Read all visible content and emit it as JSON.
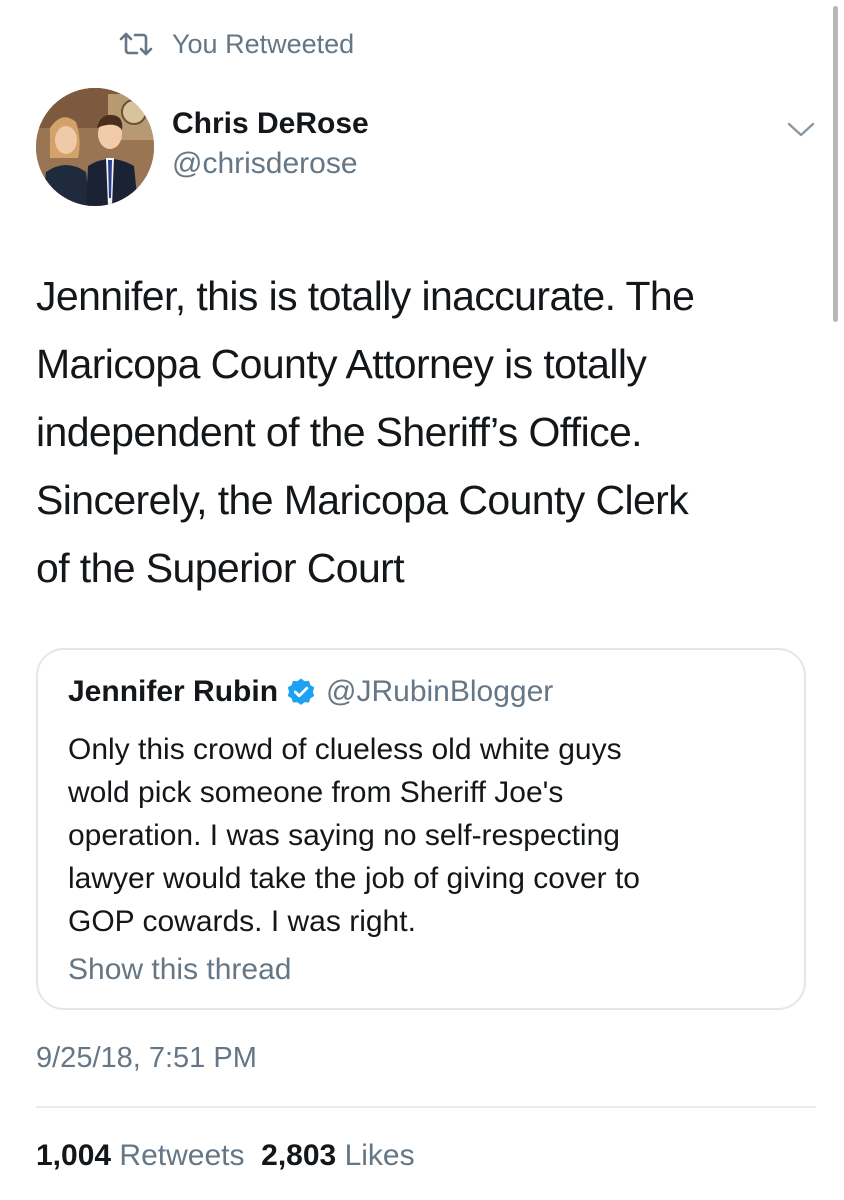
{
  "retweet_context": {
    "icon": "retweet-icon",
    "label": "You Retweeted"
  },
  "tweet": {
    "author": {
      "display_name": "Chris DeRose",
      "handle": "@chrisderose",
      "avatar": "avatar-photo"
    },
    "menu_icon": "chevron-down-icon",
    "text_lines": [
      "Jennifer, this is totally inaccurate.  The",
      "Maricopa County Attorney is totally",
      "independent of the Sheriff’s Office.",
      "Sincerely, the Maricopa County Clerk",
      "of the Superior Court"
    ],
    "quoted_tweet": {
      "display_name": "Jennifer Rubin",
      "verified_icon": "verified-badge-icon",
      "handle": "@JRubinBlogger",
      "text_lines": [
        "Only this crowd of clueless old white guys",
        "wold pick someone from Sheriff Joe's",
        "operation. I was saying no self-respecting",
        "lawyer would take the job of giving cover to",
        "GOP cowards. I was right."
      ],
      "show_thread_label": "Show this thread"
    },
    "timestamp": "9/25/18, 7:51 PM",
    "stats": {
      "retweets_count": "1,004",
      "retweets_label": "Retweets",
      "likes_count": "2,803",
      "likes_label": "Likes"
    }
  },
  "colors": {
    "text_primary": "#14171a",
    "text_secondary": "#657786",
    "verified_blue": "#1da1f2",
    "border": "#e1e8ed"
  }
}
